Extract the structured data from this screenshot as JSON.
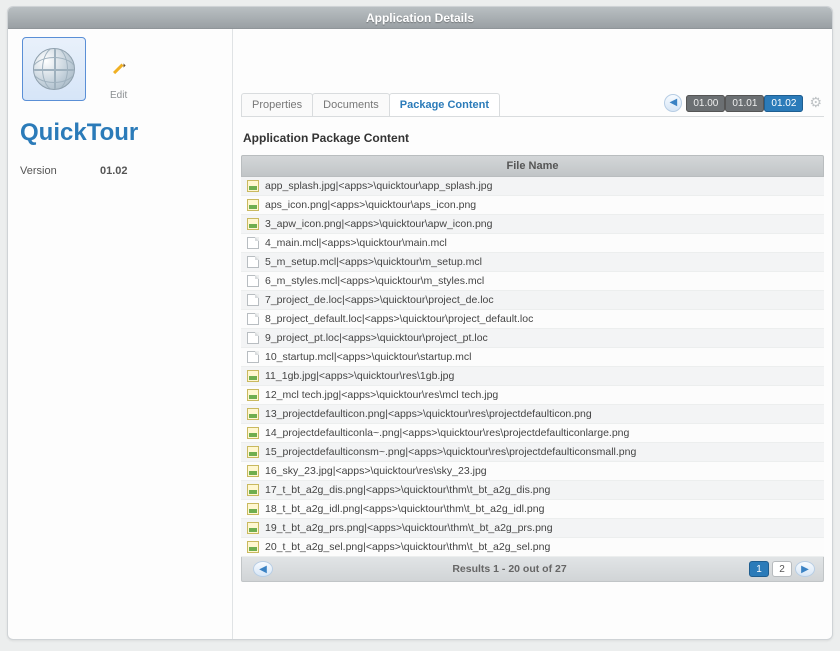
{
  "title": "Application Details",
  "edit_label": "Edit",
  "app_name": "QuickTour",
  "version_label": "Version",
  "version_value": "01.02",
  "tabs": {
    "properties": "Properties",
    "documents": "Documents",
    "package": "Package Content"
  },
  "versions": [
    "01.00",
    "01.01",
    "01.02"
  ],
  "active_version": "01.02",
  "section_heading": "Application Package Content",
  "column_header": "File Name",
  "files": [
    {
      "t": "img",
      "txt": "app_splash.jpg|<apps>\\quicktour\\app_splash.jpg"
    },
    {
      "t": "img",
      "txt": "aps_icon.png|<apps>\\quicktour\\aps_icon.png"
    },
    {
      "t": "img",
      "txt": "3_apw_icon.png|<apps>\\quicktour\\apw_icon.png"
    },
    {
      "t": "doc",
      "txt": "4_main.mcl|<apps>\\quicktour\\main.mcl"
    },
    {
      "t": "doc",
      "txt": "5_m_setup.mcl|<apps>\\quicktour\\m_setup.mcl"
    },
    {
      "t": "doc",
      "txt": "6_m_styles.mcl|<apps>\\quicktour\\m_styles.mcl"
    },
    {
      "t": "doc",
      "txt": "7_project_de.loc|<apps>\\quicktour\\project_de.loc"
    },
    {
      "t": "doc",
      "txt": "8_project_default.loc|<apps>\\quicktour\\project_default.loc"
    },
    {
      "t": "doc",
      "txt": "9_project_pt.loc|<apps>\\quicktour\\project_pt.loc"
    },
    {
      "t": "doc",
      "txt": "10_startup.mcl|<apps>\\quicktour\\startup.mcl"
    },
    {
      "t": "img",
      "txt": "11_1gb.jpg|<apps>\\quicktour\\res\\1gb.jpg"
    },
    {
      "t": "img",
      "txt": "12_mcl tech.jpg|<apps>\\quicktour\\res\\mcl tech.jpg"
    },
    {
      "t": "img",
      "txt": "13_projectdefaulticon.png|<apps>\\quicktour\\res\\projectdefaulticon.png"
    },
    {
      "t": "img",
      "txt": "14_projectdefaulticonla~.png|<apps>\\quicktour\\res\\projectdefaulticonlarge.png"
    },
    {
      "t": "img",
      "txt": "15_projectdefaulticonsm~.png|<apps>\\quicktour\\res\\projectdefaulticonsmall.png"
    },
    {
      "t": "img",
      "txt": "16_sky_23.jpg|<apps>\\quicktour\\res\\sky_23.jpg"
    },
    {
      "t": "img",
      "txt": "17_t_bt_a2g_dis.png|<apps>\\quicktour\\thm\\t_bt_a2g_dis.png"
    },
    {
      "t": "img",
      "txt": "18_t_bt_a2g_idl.png|<apps>\\quicktour\\thm\\t_bt_a2g_idl.png"
    },
    {
      "t": "img",
      "txt": "19_t_bt_a2g_prs.png|<apps>\\quicktour\\thm\\t_bt_a2g_prs.png"
    },
    {
      "t": "img",
      "txt": "20_t_bt_a2g_sel.png|<apps>\\quicktour\\thm\\t_bt_a2g_sel.png"
    }
  ],
  "results_text": "Results 1 - 20 out of 27",
  "pages": [
    "1",
    "2"
  ]
}
